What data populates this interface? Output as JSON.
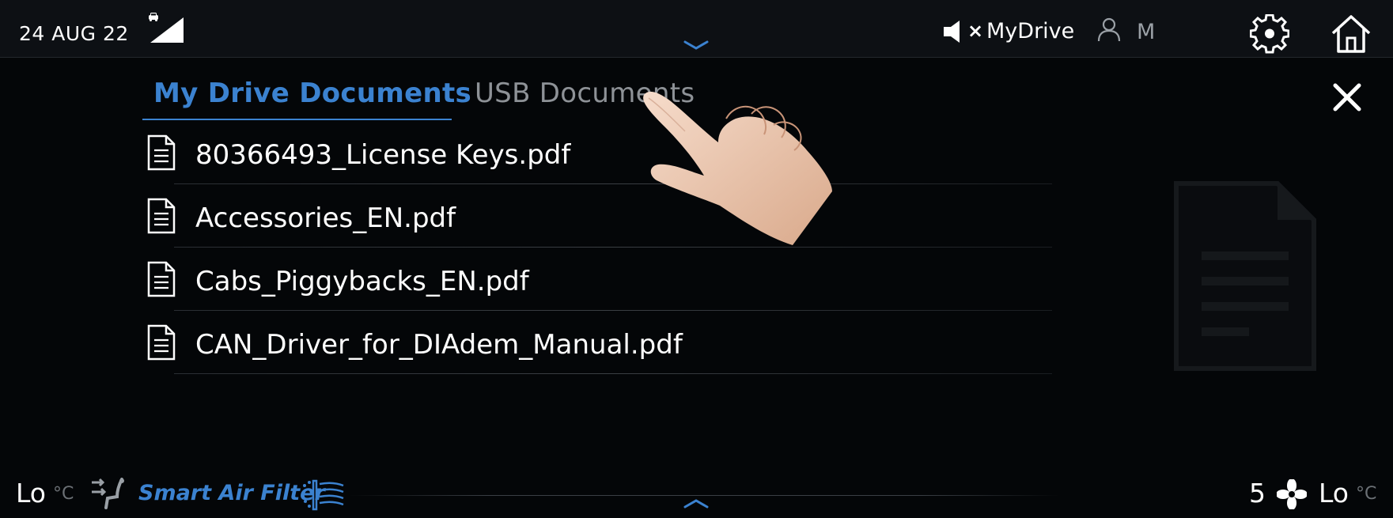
{
  "status_bar": {
    "date": "24 AUG 22",
    "audio_source": "MyDrive",
    "profile_initial": "M",
    "icons": {
      "car": "car-icon",
      "signal": "signal-icon",
      "mute": "volume-mute-icon",
      "profile": "profile-icon",
      "settings": "gear-icon",
      "home": "home-icon",
      "pull_down": "chevron-down-icon"
    }
  },
  "tabs": [
    {
      "label": "My Drive Documents",
      "active": true
    },
    {
      "label": "USB Documents",
      "active": false
    }
  ],
  "files": [
    {
      "name": "80366493_License Keys.pdf",
      "icon": "document-icon"
    },
    {
      "name": "Accessories_EN.pdf",
      "icon": "document-icon"
    },
    {
      "name": "Cabs_Piggybacks_EN.pdf",
      "icon": "document-icon"
    },
    {
      "name": "CAN_Driver_for_DIAdem_Manual.pdf",
      "icon": "document-icon"
    }
  ],
  "preview_icon": "document-preview-icon",
  "close_icon": "close-icon",
  "climate": {
    "left_temp": "Lo",
    "left_unit": "°C",
    "air_filter_label": "Smart Air Filter",
    "fan_level": "5",
    "right_temp": "Lo",
    "right_unit": "°C",
    "icons": {
      "seat": "seat-airflow-icon",
      "air_filter": "air-filter-icon",
      "fan": "fan-icon",
      "pull_up": "chevron-up-icon"
    }
  },
  "colors": {
    "accent": "#3b82d0",
    "background": "#040608",
    "status_bar": "#0d1014",
    "inactive_text": "#8e9297"
  }
}
